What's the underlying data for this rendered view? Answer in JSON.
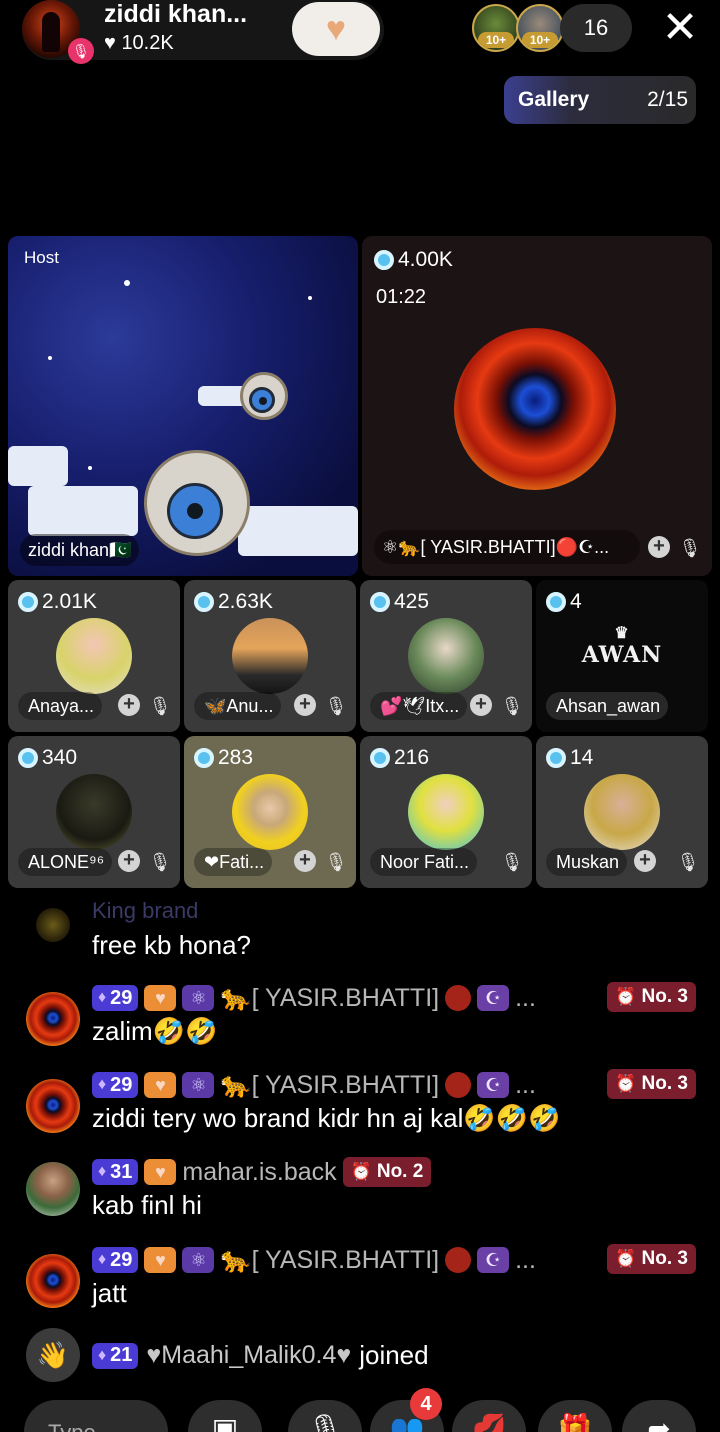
{
  "host": {
    "name": "ziddi khan...",
    "likes": "10.2K",
    "viewer_badges": [
      "10+",
      "10+"
    ],
    "viewer_count": "16"
  },
  "gallery": {
    "label": "Gallery",
    "page": "2/15"
  },
  "grid": {
    "host_tile": {
      "label": "Host",
      "name": "ziddi khan🇵🇰"
    },
    "big_tile": {
      "coins": "4.00K",
      "timer": "01:22",
      "name": "⚛🐆[ YASIR.BHATTI]🔴☪..."
    },
    "small_tiles": [
      {
        "coins": "2.01K",
        "name": "Anaya..."
      },
      {
        "coins": "2.63K",
        "name": "🦋Anu..."
      },
      {
        "coins": "425",
        "name": "💕🕊Itx..."
      },
      {
        "coins": "4",
        "name": "Ahsan_awan",
        "logo": "AWAN"
      },
      {
        "coins": "340",
        "name": "ALONE⁹⁶"
      },
      {
        "coins": "283",
        "name": "❤Fati..."
      },
      {
        "coins": "216",
        "name": "Noor Fati..."
      },
      {
        "coins": "14",
        "name": "Muskan"
      }
    ]
  },
  "chat": {
    "cut_off_name": "King brand",
    "cut_off_text": "free kb hona?",
    "messages": [
      {
        "level": "29",
        "user": "[ YASIR.BHATTI]",
        "rank": "No. 3",
        "text": "zalim🤣🤣"
      },
      {
        "level": "29",
        "user": "[ YASIR.BHATTI]",
        "rank": "No. 3",
        "text": "ziddi tery wo brand kidr hn aj kal🤣🤣🤣"
      },
      {
        "level": "31",
        "user": "mahar.is.back",
        "rank": "No. 2",
        "text": "kab finl hi"
      },
      {
        "level": "29",
        "user": "[ YASIR.BHATTI]",
        "rank": "No. 3",
        "text": "jatt"
      }
    ],
    "joined": {
      "level": "21",
      "user": "♥Maahi_Malik0.4♥",
      "action": "joined"
    }
  },
  "bottom": {
    "type_placeholder": "Type...",
    "notif_count": "4"
  },
  "colors": {
    "level_badge": "#4a3bd4",
    "rank_badge": "#7a1d2c",
    "coin": "#58c1f0"
  }
}
